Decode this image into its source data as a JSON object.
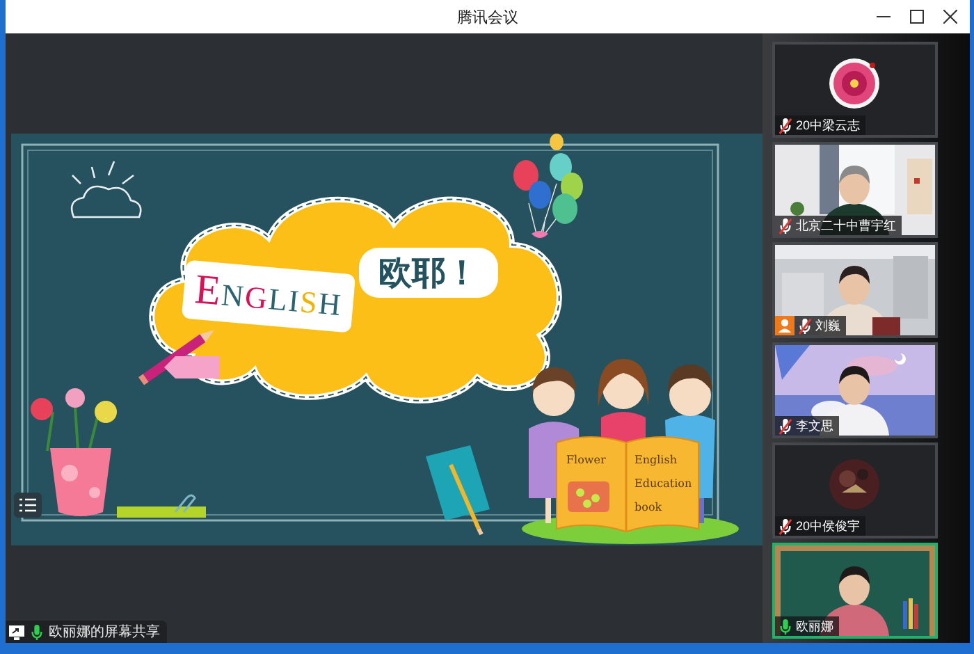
{
  "window": {
    "title": "腾讯会议"
  },
  "slide": {
    "title": {
      "text": "ENGLISH"
    },
    "greeting": "欧耶！",
    "book": {
      "left_page": "Flower",
      "right_page": [
        "English",
        "Education",
        "book"
      ]
    }
  },
  "share": {
    "label": "欧丽娜的屏幕共享",
    "muted": false
  },
  "participants": [
    {
      "name": "20中梁云志",
      "kind": "avatar",
      "muted": true,
      "host": false,
      "speaking": false
    },
    {
      "name": "北京二十中曹宇红",
      "kind": "video",
      "muted": true,
      "host": false,
      "speaking": false
    },
    {
      "name": "刘巍",
      "kind": "video",
      "muted": true,
      "host": true,
      "speaking": false
    },
    {
      "name": "李文思",
      "kind": "video",
      "muted": true,
      "host": false,
      "speaking": false
    },
    {
      "name": "20中侯俊宇",
      "kind": "avatar",
      "muted": true,
      "host": false,
      "speaking": false
    },
    {
      "name": "欧丽娜",
      "kind": "video",
      "muted": false,
      "host": false,
      "speaking": true
    }
  ]
}
